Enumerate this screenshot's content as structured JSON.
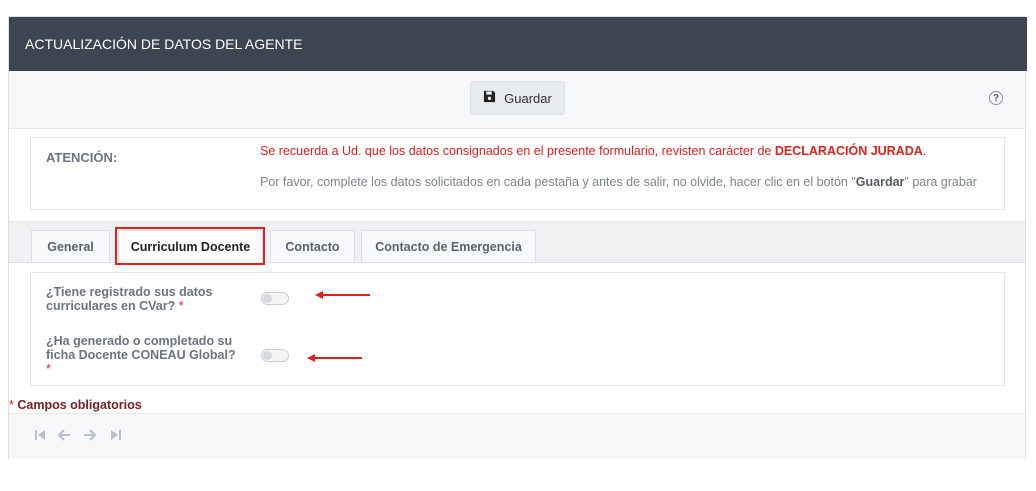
{
  "header": {
    "title": "ACTUALIZACIÓN DE DATOS DEL AGENTE"
  },
  "toolbar": {
    "save_label": "Guardar",
    "help_glyph": "?"
  },
  "notice": {
    "label": "ATENCIÓN:",
    "line1_text": "Se recuerda a Ud. que los datos consignados en el presente formulario, revisten carácter de ",
    "line1_bold": "DECLARACIÓN JURADA",
    "line1_end": ".",
    "line2_start": "Por favor, complete los datos solicitados en cada pestaña y antes de salir, no olvide, hacer clic en el botón \"",
    "line2_bold": "Guardar",
    "line2_end": "\" para grabar"
  },
  "tabs": [
    {
      "label": "General",
      "active": false
    },
    {
      "label": "Curriculum Docente",
      "active": true
    },
    {
      "label": "Contacto",
      "active": false
    },
    {
      "label": "Contacto de Emergencia",
      "active": false
    }
  ],
  "form": {
    "q1": {
      "label": "¿Tiene registrado sus datos curriculares en CVar?",
      "required_mark": "*",
      "checked": false
    },
    "q2": {
      "label": "¿Ha generado o completado su ficha Docente CONEAU Global?",
      "required_mark": "*",
      "checked": false
    }
  },
  "required_note": {
    "star": "*",
    "text": " Campos obligatorios"
  },
  "colors": {
    "header_bg": "#3d4550",
    "accent_red": "#e0201b",
    "label_gray": "#6b7480"
  },
  "icons": [
    "save-icon",
    "help-icon",
    "first-page-icon",
    "prev-icon",
    "next-icon",
    "last-page-icon",
    "annotation-arrow-icon"
  ]
}
